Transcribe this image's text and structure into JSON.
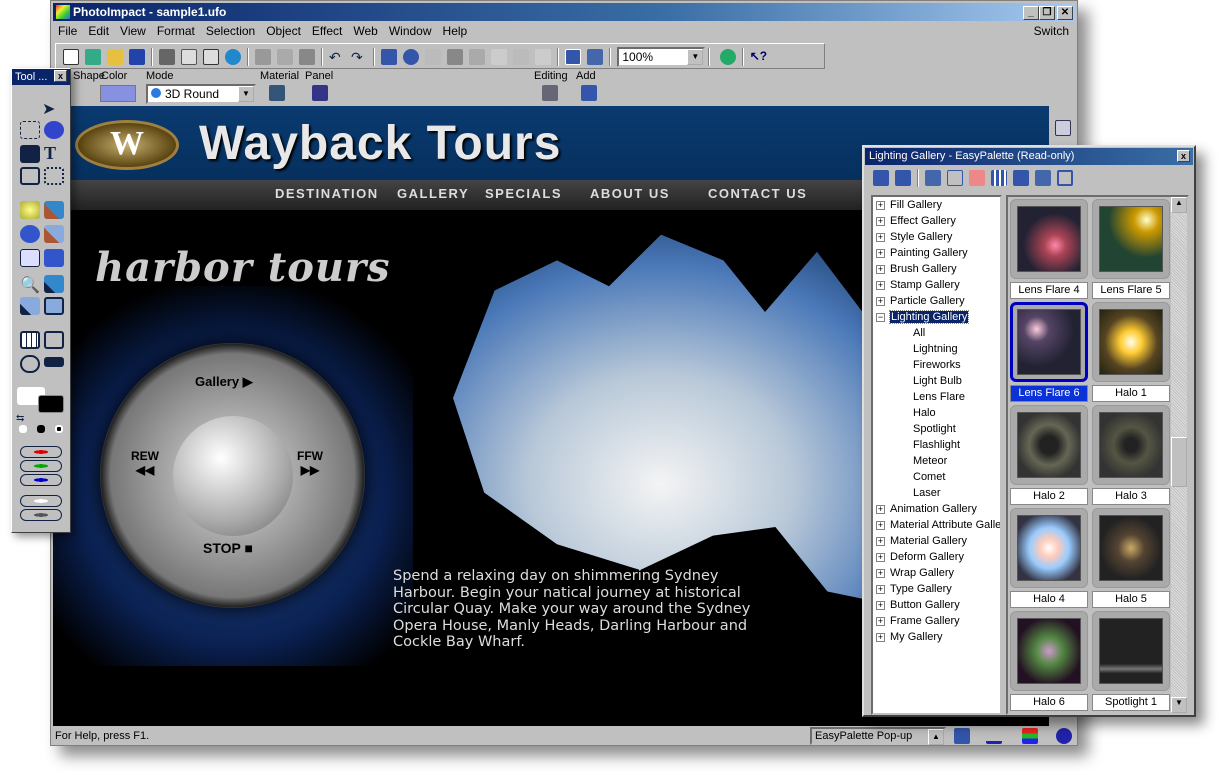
{
  "window": {
    "title": "PhotoImpact - sample1.ufo",
    "min": "_",
    "restore": "❐",
    "close": "✕"
  },
  "menu": {
    "items": [
      "File",
      "Edit",
      "View",
      "Format",
      "Selection",
      "Object",
      "Effect",
      "Web",
      "Window",
      "Help"
    ],
    "switch": "Switch"
  },
  "toolbar": {
    "zoom": "100%"
  },
  "attr_bar": {
    "shape_label": "Shape",
    "color_label": "Color",
    "color_value": "#8890e0",
    "mode_label": "Mode",
    "mode_value": "3D Round",
    "material_label": "Material",
    "panel_label": "Panel",
    "editing_label": "Editing",
    "add_label": "Add"
  },
  "tool_panel": {
    "title": "Tool ...",
    "close": "x"
  },
  "canvas": {
    "logo_letter": "W",
    "brand": "Wayback Tours",
    "nav": [
      "DESTINATION",
      "GALLERY",
      "SPECIALS",
      "ABOUT US",
      "CONTACT US"
    ],
    "heading": "harbor tours",
    "controls": {
      "gallery": "Gallery ▶",
      "rew": "REW",
      "rew_icon": "◀◀",
      "ffw": "FFW",
      "ffw_icon": "▶▶",
      "stop": "STOP ■"
    },
    "body": "Spend a relaxing day on shimmering Sydney Harbour. Begin your natical journey at historical Circular Quay. Make your way around the Sydney Opera House, Manly Heads, Darling Harbour and Cockle Bay Wharf."
  },
  "status": {
    "help": "For Help, press F1.",
    "palette_combo": "EasyPalette Pop-up"
  },
  "palette": {
    "title": "Lighting Gallery - EasyPalette (Read-only)",
    "close": "x",
    "tree": [
      {
        "label": "Fill Gallery",
        "expanded": false
      },
      {
        "label": "Effect Gallery",
        "expanded": false
      },
      {
        "label": "Style Gallery",
        "expanded": false
      },
      {
        "label": "Painting Gallery",
        "expanded": false
      },
      {
        "label": "Brush Gallery",
        "expanded": false
      },
      {
        "label": "Stamp Gallery",
        "expanded": false
      },
      {
        "label": "Particle Gallery",
        "expanded": false
      },
      {
        "label": "Lighting Gallery",
        "expanded": true,
        "selected": true,
        "children": [
          "All",
          "Lightning",
          "Fireworks",
          "Light Bulb",
          "Lens Flare",
          "Halo",
          "Spotlight",
          "Flashlight",
          "Meteor",
          "Comet",
          "Laser"
        ]
      },
      {
        "label": "Animation Gallery",
        "expanded": false
      },
      {
        "label": "Material Attribute Gallery",
        "expanded": false
      },
      {
        "label": "Material Gallery",
        "expanded": false
      },
      {
        "label": "Deform Gallery",
        "expanded": false
      },
      {
        "label": "Wrap Gallery",
        "expanded": false
      },
      {
        "label": "Type Gallery",
        "expanded": false
      },
      {
        "label": "Button Gallery",
        "expanded": false
      },
      {
        "label": "Frame Gallery",
        "expanded": false
      },
      {
        "label": "My Gallery",
        "expanded": false
      }
    ],
    "thumbnails": [
      {
        "label": "Lens Flare 4"
      },
      {
        "label": "Lens Flare 5"
      },
      {
        "label": "Lens Flare 6",
        "selected": true
      },
      {
        "label": "Halo 1"
      },
      {
        "label": "Halo 2"
      },
      {
        "label": "Halo 3"
      },
      {
        "label": "Halo 4"
      },
      {
        "label": "Halo 5"
      },
      {
        "label": "Halo 6"
      },
      {
        "label": "Spotlight 1"
      }
    ]
  }
}
